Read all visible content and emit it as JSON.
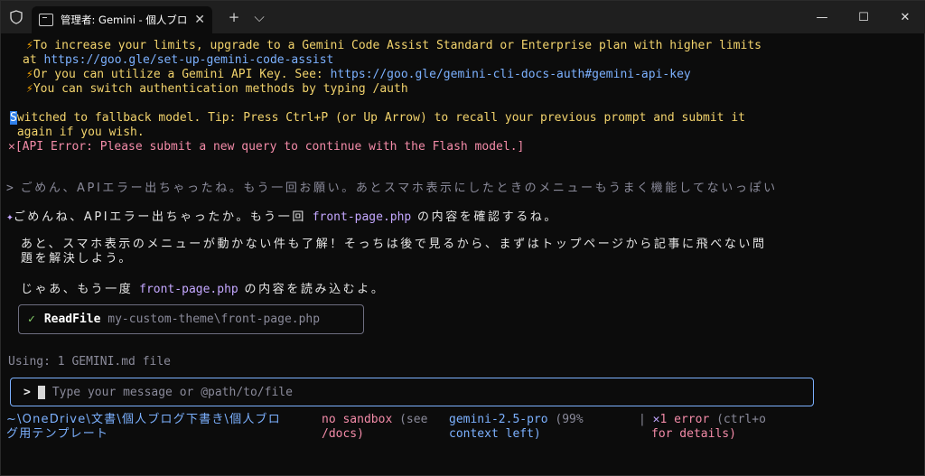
{
  "window": {
    "tab_title": "管理者: Gemini - 個人ブログ用テ",
    "new_tab": "+",
    "dropdown": "⌵",
    "minimize": "—",
    "maximize": "☐",
    "close": "✕"
  },
  "notices": {
    "line1": "To increase your limits, upgrade to a Gemini Code Assist Standard or Enterprise plan with higher limits",
    "line1_prefix": "at ",
    "line1_link": "https://goo.gle/set-up-gemini-code-assist",
    "line2": "Or you can utilize a Gemini API Key. See: ",
    "line2_link": "https://goo.gle/gemini-cli-docs-auth#gemini-api-key",
    "line3": "You can switch authentication methods by typing /auth"
  },
  "fallback": {
    "badge": "S",
    "line1": "witched to fallback model. Tip: Press Ctrl+P (or Up Arrow) to recall your previous prompt and submit it",
    "line2": " again if you wish."
  },
  "error": {
    "icon": "✕",
    "text": "[API Error: Please submit a new query to continue with the Flash model.]"
  },
  "user_prompt": {
    "marker": ">",
    "text": "ごめん、APIエラー出ちゃったね。もう一回お願い。あとスマホ表示にしたときのメニューもうまく機能してないっぽい"
  },
  "reply": {
    "marker": "✦",
    "p1_a": "ごめんね、APIエラー出ちゃったか。もう一回 ",
    "p1_file": "front-page.php",
    "p1_b": " の内容を確認するね。",
    "p2_l1": "あと、スマホ表示のメニューが動かない件も了解！そっちは後で見るから、まずはトップページから記事に飛べない問",
    "p2_l2": "題を解決しよう。",
    "p3_a": "じゃあ、もう一度 ",
    "p3_file": "front-page.php",
    "p3_b": " の内容を読み込むよ。"
  },
  "tool_call": {
    "check": "✓",
    "name": "ReadFile",
    "path": "my-custom-theme\\front-page.php"
  },
  "using": "Using: 1 GEMINI.md file",
  "input": {
    "prompt": ">",
    "placeholder": "Type your message or @path/to/file"
  },
  "footer": {
    "path_l1": "~\\OneDrive\\文書\\個人ブログ下書き\\個人ブロ",
    "path_l2": "グ用テンプレート",
    "sandbox_a": "no sandbox",
    "sandbox_b": " (see",
    "sandbox_c": "/docs)",
    "model": "gemini-2.5-pro",
    "ctx_a": " (99%",
    "ctx_b": "context left)",
    "sep": "|",
    "err_icon": "✕",
    "err_count": "1 error",
    "err_hint_a": " (ctrl+o",
    "err_hint_b": "for details)"
  }
}
